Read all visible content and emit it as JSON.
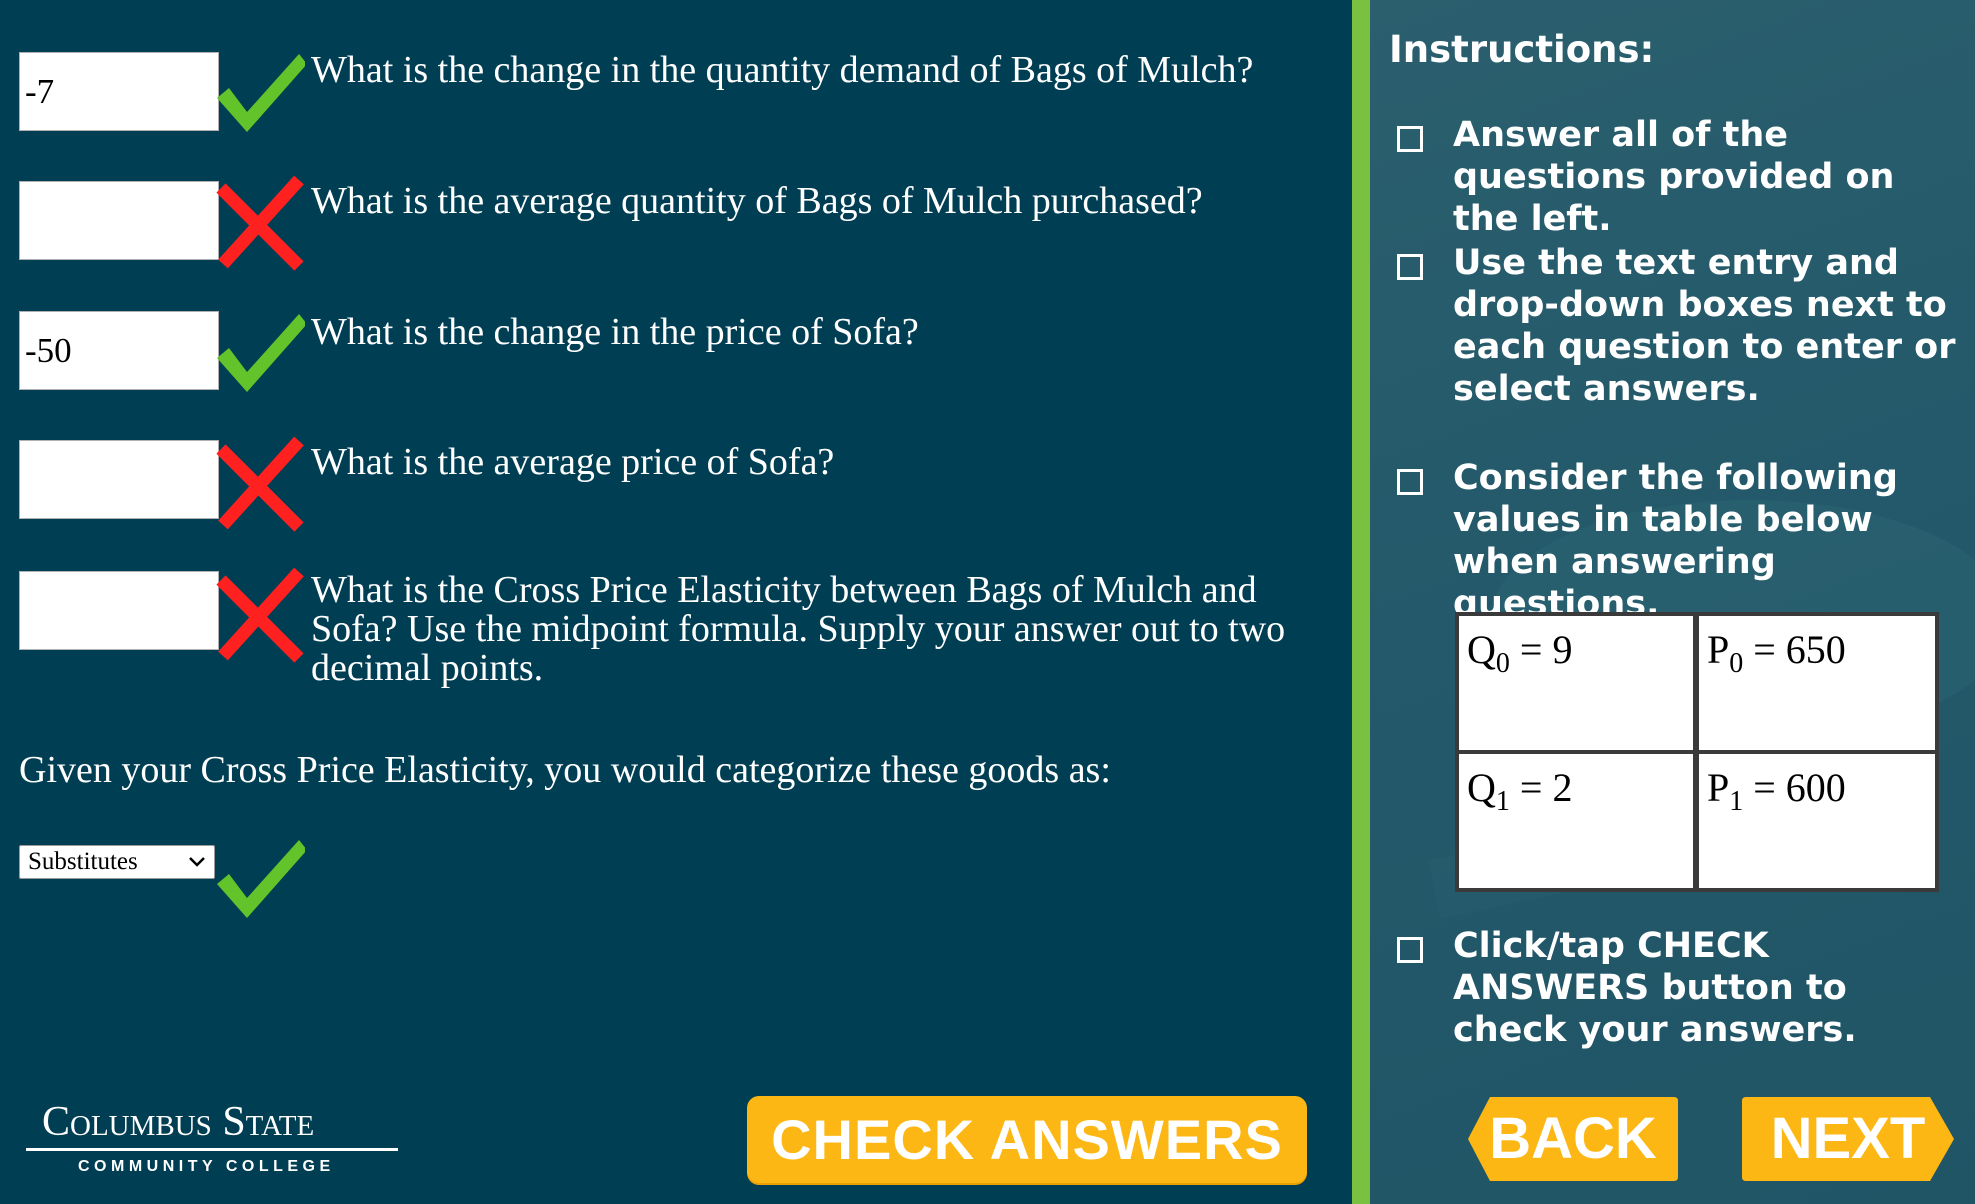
{
  "questions": [
    {
      "value": "-7",
      "text": "What is the change in the quantity demand of Bags of Mulch?",
      "status": "correct"
    },
    {
      "value": "",
      "text": "What is the average quantity of Bags of Mulch purchased?",
      "status": "incorrect"
    },
    {
      "value": "-50",
      "text": "What is the change in the price of Sofa?",
      "status": "correct"
    },
    {
      "value": "",
      "text": "What is the average price of Sofa?",
      "status": "incorrect"
    },
    {
      "value": "",
      "text": "What is the Cross Price Elasticity between Bags of Mulch  and Sofa? Use the midpoint formula. Supply your answer out to two decimal points.",
      "status": "incorrect"
    }
  ],
  "category": {
    "prompt": "Given your Cross Price Elasticity, you would categorize these goods as:",
    "selected": "Substitutes",
    "status": "correct"
  },
  "logo": {
    "line1": "Columbus State",
    "line2": "COMMUNITY COLLEGE"
  },
  "check_answers_label": "CHECK ANSWERS",
  "instructions": {
    "title": "Instructions:",
    "items": [
      "Answer all of the questions provided on the left.",
      "Use the text entry and drop-down boxes next to each question to enter or select answers.",
      "Consider the following values in table below when answering questions.",
      "Click/tap CHECK ANSWERS button to check your answers."
    ]
  },
  "values_table": {
    "q0": {
      "sym": "Q",
      "sub": "0",
      "rest": " = 9"
    },
    "p0": {
      "sym": "P",
      "sub": "0",
      "rest": " = 650"
    },
    "q1": {
      "sym": "Q",
      "sub": "1",
      "rest": " = 2"
    },
    "p1": {
      "sym": "P",
      "sub": "1",
      "rest": " = 600"
    }
  },
  "nav": {
    "back_label": "BACK",
    "next_label": "NEXT"
  },
  "colors": {
    "left_bg": "#003e53",
    "right_bg": "#23596a",
    "divider": "#7ac142",
    "button": "#fdb714",
    "correct": "#62c42a",
    "incorrect": "#ff2020"
  },
  "icons": {
    "correct": "checkmark-icon",
    "incorrect": "x-mark-icon"
  }
}
